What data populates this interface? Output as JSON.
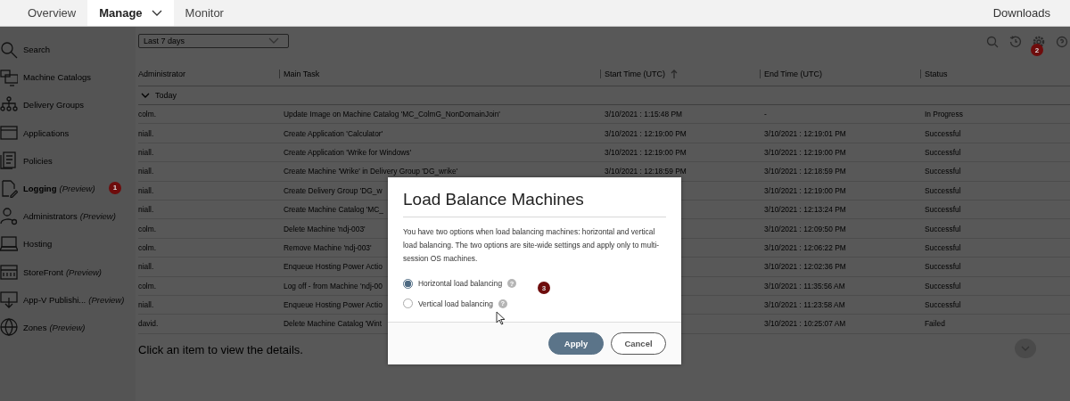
{
  "top_nav": {
    "tabs": [
      {
        "label": "Overview",
        "selected": false,
        "dropdown": false
      },
      {
        "label": "Manage",
        "selected": true,
        "dropdown": true
      },
      {
        "label": "Monitor",
        "selected": false,
        "dropdown": false
      }
    ],
    "right_link": "Downloads"
  },
  "sidebar": {
    "items": [
      {
        "label": "Search",
        "selected": false
      },
      {
        "label": "Machine Catalogs",
        "selected": false
      },
      {
        "label": "Delivery Groups",
        "selected": false
      },
      {
        "label": "Applications",
        "selected": false
      },
      {
        "label": "Policies",
        "selected": false
      },
      {
        "label": "Logging",
        "tag": "(Preview)",
        "selected": true,
        "badge": "1"
      },
      {
        "label": "Administrators",
        "tag": "(Preview)",
        "selected": false
      },
      {
        "label": "Hosting",
        "selected": false
      },
      {
        "label": "StoreFront",
        "tag": "(Preview)",
        "selected": false
      },
      {
        "label": "App-V Publishi...",
        "tag": "(Preview)",
        "selected": false
      },
      {
        "label": "Zones",
        "tag": "(Preview)",
        "selected": false
      }
    ]
  },
  "filter": {
    "value": "Last 7 days"
  },
  "toolbar": {
    "badge": "2"
  },
  "table": {
    "columns": [
      {
        "label": "Administrator",
        "sorted": false
      },
      {
        "label": "Main Task",
        "sorted": false
      },
      {
        "label": "Start Time (UTC)",
        "sorted": true
      },
      {
        "label": "End Time (UTC)",
        "sorted": false
      },
      {
        "label": "Status",
        "sorted": false
      }
    ],
    "group": "Today",
    "rows": [
      {
        "admin": "colm.",
        "task": "Update Image on Machine Catalog 'MC_ColmG_NonDomainJoin'",
        "start": "3/10/2021 : 1:15:48 PM",
        "end": "-",
        "status": "In Progress"
      },
      {
        "admin": "niall.",
        "task": "Create Application 'Calculator'",
        "start": "3/10/2021 : 12:19:00 PM",
        "end": "3/10/2021 : 12:19:01 PM",
        "status": "Successful"
      },
      {
        "admin": "niall.",
        "task": "Create Application 'Wrike for Windows'",
        "start": "3/10/2021 : 12:19:00 PM",
        "end": "3/10/2021 : 12:19:00 PM",
        "status": "Successful"
      },
      {
        "admin": "niall.",
        "task": "Create Machine 'Wrike' in Delivery Group 'DG_wrike'",
        "start": "3/10/2021 : 12:18:59 PM",
        "end": "3/10/2021 : 12:18:59 PM",
        "status": "Successful"
      },
      {
        "admin": "niall.",
        "task": "Create Delivery Group 'DG_w",
        "end": "3/10/2021 : 12:19:00 PM",
        "status": "Successful"
      },
      {
        "admin": "niall.",
        "task": "Create Machine Catalog 'MC_",
        "end": "3/10/2021 : 12:13:24 PM",
        "status": "Successful"
      },
      {
        "admin": "colm.",
        "task": "Delete Machine 'ndj-003'",
        "end": "3/10/2021 : 12:09:50 PM",
        "status": "Successful"
      },
      {
        "admin": "colm.",
        "task": "Remove Machine 'ndj-003'",
        "end": "3/10/2021 : 12:06:22 PM",
        "status": "Successful"
      },
      {
        "admin": "niall.",
        "task": "Enqueue Hosting Power Actio",
        "end": "3/10/2021 : 12:02:36 PM",
        "status": "Successful"
      },
      {
        "admin": "colm.",
        "task": "Log off - from Machine 'ndj-00",
        "end": "3/10/2021 : 11:35:56 AM",
        "status": "Successful"
      },
      {
        "admin": "niall.",
        "task": "Enqueue Hosting Power Actio",
        "end": "3/10/2021 : 11:23:58 AM",
        "status": "Successful"
      },
      {
        "admin": "david.",
        "task": "Delete Machine Catalog 'Wint",
        "end": "3/10/2021 : 10:25:07 AM",
        "status": "Failed"
      }
    ]
  },
  "details_hint": "Click an item to view the details.",
  "dialog": {
    "title": "Load Balance Machines",
    "body": "You have two options when load balancing machines: horizontal and vertical load balancing. The two options are site-wide settings and apply only to multi-session OS machines.",
    "options": [
      {
        "label": "Horizontal load balancing",
        "selected": true,
        "help": "?"
      },
      {
        "label": "Vertical load balancing",
        "selected": false,
        "help": "?"
      }
    ],
    "badge": "3",
    "buttons": [
      {
        "label": "Apply",
        "kind": "primary"
      },
      {
        "label": "Cancel",
        "kind": "secondary"
      }
    ]
  }
}
